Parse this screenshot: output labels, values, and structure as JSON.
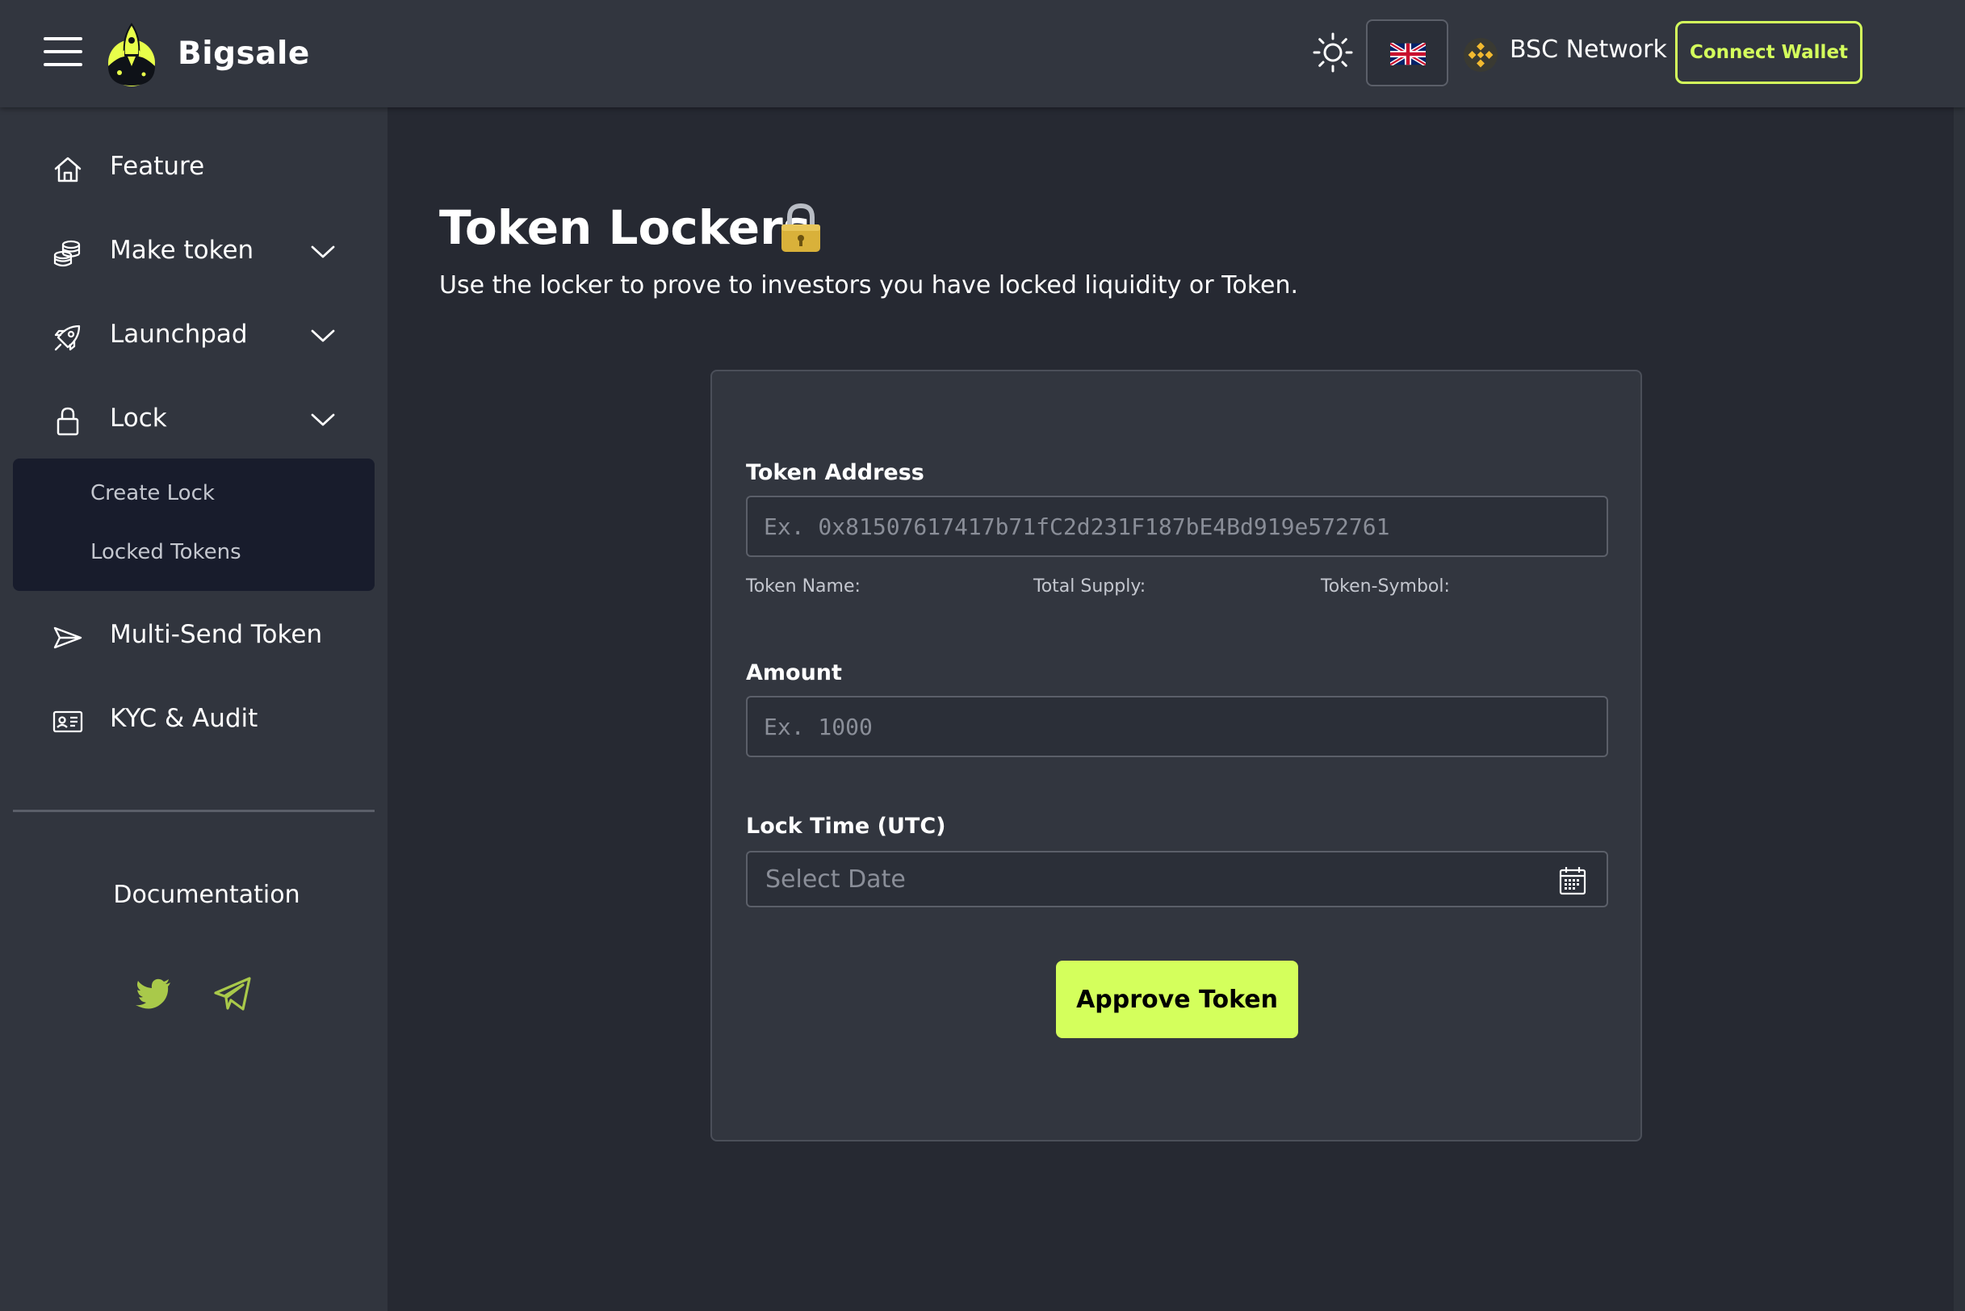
{
  "app": {
    "brand": "Bigsale"
  },
  "header": {
    "network_label": "BSC Network",
    "connect_label": "Connect Wallet",
    "accent_color": "#d4ff5c"
  },
  "sidebar": {
    "items": [
      {
        "label": "Feature",
        "icon": "home-icon"
      },
      {
        "label": "Make token",
        "icon": "coins-icon"
      },
      {
        "label": "Launchpad",
        "icon": "rocket-icon"
      },
      {
        "label": "Lock",
        "icon": "lock-icon"
      },
      {
        "label": "Multi-Send Token",
        "icon": "send-icon"
      },
      {
        "label": "KYC & Audit",
        "icon": "id-card-icon"
      }
    ],
    "lock_submenu": [
      "Create Lock",
      "Locked Tokens"
    ],
    "documentation": "Documentation",
    "social": [
      "twitter-icon",
      "telegram-icon"
    ]
  },
  "main": {
    "title": "Token Lockers",
    "subtitle": "Use the locker to prove to investors you have locked liquidity or Token.",
    "form": {
      "token_address_label": "Token Address",
      "token_address_placeholder": "Ex. 0x81507617417b71fC2d231F187bE4Bd919e572761",
      "token_name_label": "Token Name:",
      "total_supply_label": "Total Supply:",
      "token_symbol_label": "Token-Symbol:",
      "amount_label": "Amount",
      "amount_placeholder": "Ex. 1000",
      "lock_time_label": "Lock Time (UTC)",
      "date_placeholder": "Select Date",
      "approve_label": "Approve Token"
    }
  }
}
